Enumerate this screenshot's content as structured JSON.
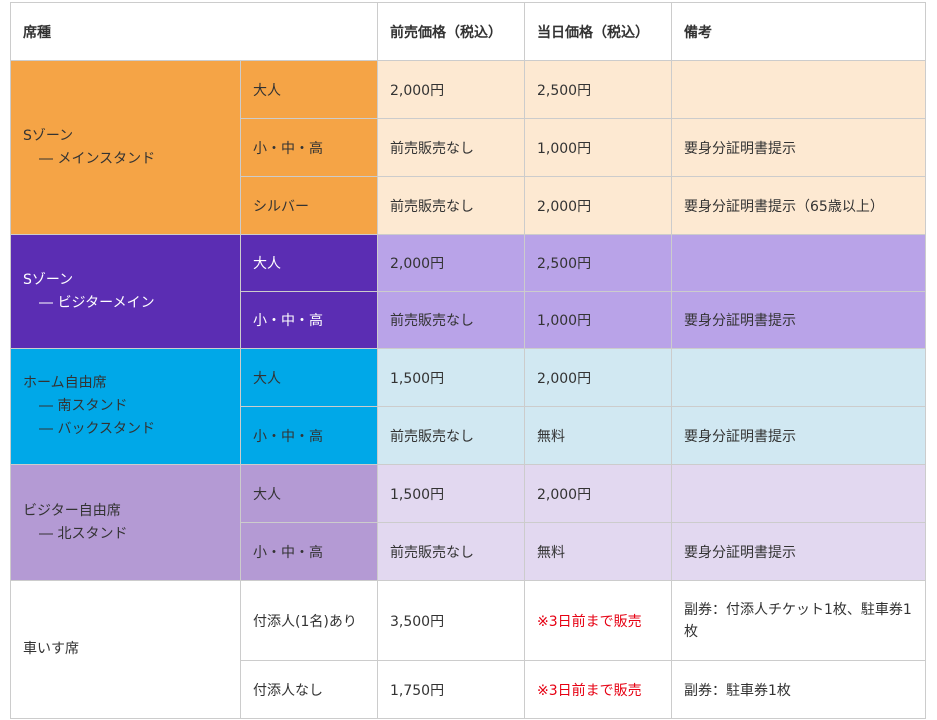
{
  "header": {
    "seat": "席種",
    "advance": "前売価格（税込）",
    "sameday": "当日価格（税込）",
    "notes": "備考"
  },
  "groups": {
    "s_main": {
      "zone_line1": "Sゾーン",
      "zone_line2": "― メインスタンド",
      "rows": [
        {
          "type": "大人",
          "advance": "2,000円",
          "sameday": "2,500円",
          "note": ""
        },
        {
          "type": "小・中・高",
          "advance": "前売販売なし",
          "sameday": "1,000円",
          "note": "要身分証明書提示"
        },
        {
          "type": "シルバー",
          "advance": "前売販売なし",
          "sameday": "2,000円",
          "note": "要身分証明書提示（65歳以上）"
        }
      ]
    },
    "s_visitor": {
      "zone_line1": "Sゾーン",
      "zone_line2": "― ビジターメイン",
      "rows": [
        {
          "type": "大人",
          "advance": "2,000円",
          "sameday": "2,500円",
          "note": ""
        },
        {
          "type": "小・中・高",
          "advance": "前売販売なし",
          "sameday": "1,000円",
          "note": "要身分証明書提示"
        }
      ]
    },
    "home_free": {
      "zone_line1": "ホーム自由席",
      "zone_line2": "― 南スタンド",
      "zone_line3": "― バックスタンド",
      "rows": [
        {
          "type": "大人",
          "advance": "1,500円",
          "sameday": "2,000円",
          "note": ""
        },
        {
          "type": "小・中・高",
          "advance": "前売販売なし",
          "sameday": "無料",
          "note": "要身分証明書提示"
        }
      ]
    },
    "visitor_free": {
      "zone_line1": "ビジター自由席",
      "zone_line2": "― 北スタンド",
      "rows": [
        {
          "type": "大人",
          "advance": "1,500円",
          "sameday": "2,000円",
          "note": ""
        },
        {
          "type": "小・中・高",
          "advance": "前売販売なし",
          "sameday": "無料",
          "note": "要身分証明書提示"
        }
      ]
    },
    "wheelchair": {
      "zone_line1": "車いす席",
      "rows": [
        {
          "type": "付添人(1名)あり",
          "advance": "3,500円",
          "sameday": "※3日前まで販売",
          "note": "副券：付添人チケット1枚、駐車券1枚"
        },
        {
          "type": "付添人なし",
          "advance": "1,750円",
          "sameday": "※3日前まで販売",
          "note": "副券：駐車券1枚"
        }
      ]
    }
  },
  "colors": {
    "s_main": "#f5a446",
    "s_visitor": "#5b2db3",
    "home_free": "#00a8e8",
    "visitor_free": "#b49ad4",
    "red_note": "#e60012"
  }
}
